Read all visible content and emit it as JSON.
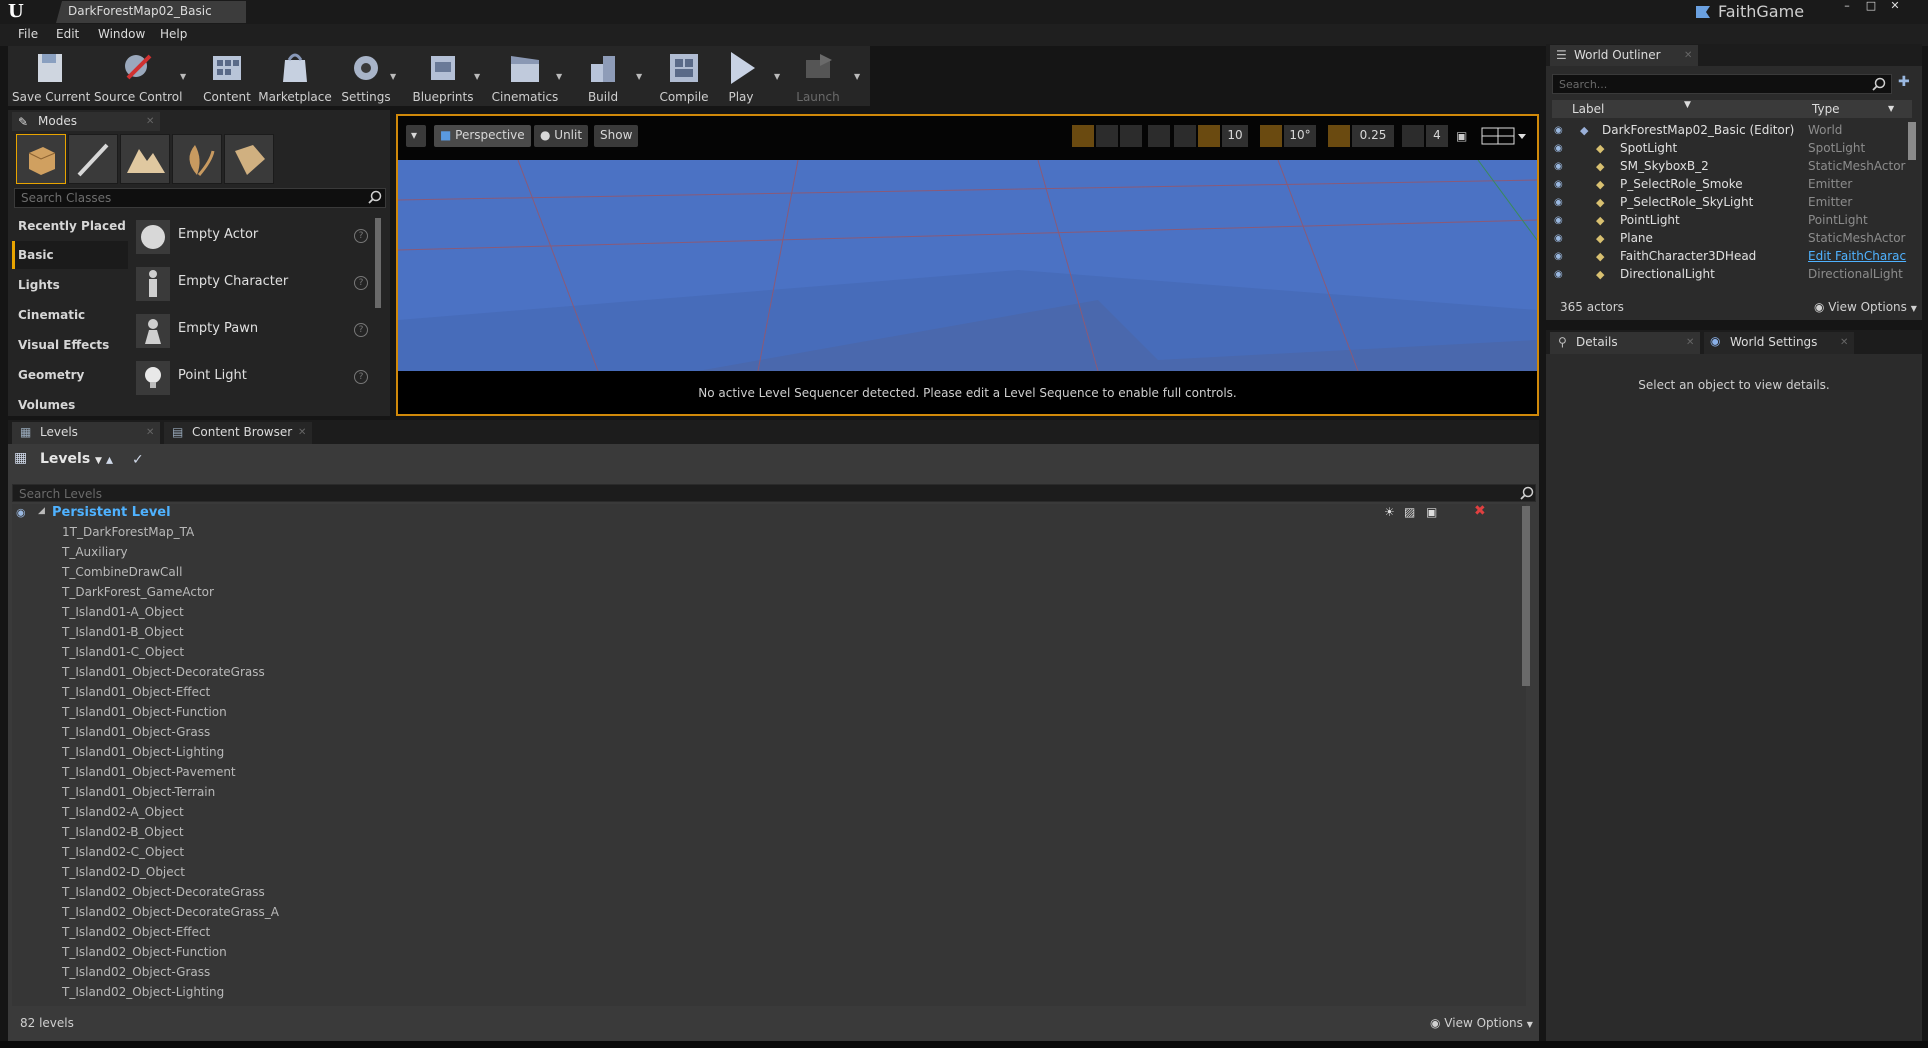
{
  "window": {
    "document_tab": "DarkForestMap02_Basic",
    "game_name": "FaithGame"
  },
  "menu": [
    "File",
    "Edit",
    "Window",
    "Help"
  ],
  "toolbar": {
    "buttons": [
      "Save Current",
      "Source Control",
      "Content",
      "Marketplace",
      "Settings",
      "Blueprints",
      "Cinematics",
      "Build",
      "Compile",
      "Play",
      "Launch"
    ]
  },
  "modes": {
    "tab_label": "Modes",
    "search_placeholder": "Search Classes",
    "categories": [
      "Recently Placed",
      "Basic",
      "Lights",
      "Cinematic",
      "Visual Effects",
      "Geometry",
      "Volumes"
    ],
    "selected_category": "Basic",
    "classes": [
      "Empty Actor",
      "Empty Character",
      "Empty Pawn",
      "Point Light"
    ]
  },
  "viewport": {
    "perspective": "Perspective",
    "lighting": "Unlit",
    "show": "Show",
    "grid_snap": "10",
    "rotation_snap": "10°",
    "scale_snap": "0.25",
    "camera_speed": "4",
    "message": "No active Level Sequencer detected. Please edit a Level Sequence to enable full controls."
  },
  "levels_panel": {
    "tab_levels": "Levels",
    "tab_content_browser": "Content Browser",
    "header": "Levels",
    "search_placeholder": "Search Levels",
    "persistent_level": "Persistent Level",
    "levels": [
      "1T_DarkForestMap_TA",
      "T_Auxiliary",
      "T_CombineDrawCall",
      "T_DarkForest_GameActor",
      "T_Island01-A_Object",
      "T_Island01-B_Object",
      "T_Island01-C_Object",
      "T_Island01_Object-DecorateGrass",
      "T_Island01_Object-Effect",
      "T_Island01_Object-Function",
      "T_Island01_Object-Grass",
      "T_Island01_Object-Lighting",
      "T_Island01_Object-Pavement",
      "T_Island01_Object-Terrain",
      "T_Island02-A_Object",
      "T_Island02-B_Object",
      "T_Island02-C_Object",
      "T_Island02-D_Object",
      "T_Island02_Object-DecorateGrass",
      "T_Island02_Object-DecorateGrass_A",
      "T_Island02_Object-Effect",
      "T_Island02_Object-Function",
      "T_Island02_Object-Grass",
      "T_Island02_Object-Lighting"
    ],
    "status": "82 levels",
    "view_options": "View Options"
  },
  "outliner": {
    "tab_label": "World Outliner",
    "search_placeholder": "Search...",
    "col_label": "Label",
    "col_type": "Type",
    "rows": [
      {
        "label": "DarkForestMap02_Basic (Editor)",
        "type": "World"
      },
      {
        "label": "SpotLight",
        "type": "SpotLight"
      },
      {
        "label": "SM_SkyboxB_2",
        "type": "StaticMeshActor"
      },
      {
        "label": "P_SelectRole_Smoke",
        "type": "Emitter"
      },
      {
        "label": "P_SelectRole_SkyLight",
        "type": "Emitter"
      },
      {
        "label": "PointLight",
        "type": "PointLight"
      },
      {
        "label": "Plane",
        "type": "StaticMeshActor"
      },
      {
        "label": "FaithCharacter3DHead",
        "type": "Edit FaithCharac"
      },
      {
        "label": "DirectionalLight",
        "type": "DirectionalLight"
      }
    ],
    "count": "365 actors",
    "view_options": "View Options"
  },
  "details": {
    "tab_details": "Details",
    "tab_world_settings": "World Settings",
    "empty_message": "Select an object to view details."
  },
  "colors": {
    "accent": "#e8a400",
    "link": "#4fb2ff",
    "viewport_sky": "#4b72c4"
  }
}
